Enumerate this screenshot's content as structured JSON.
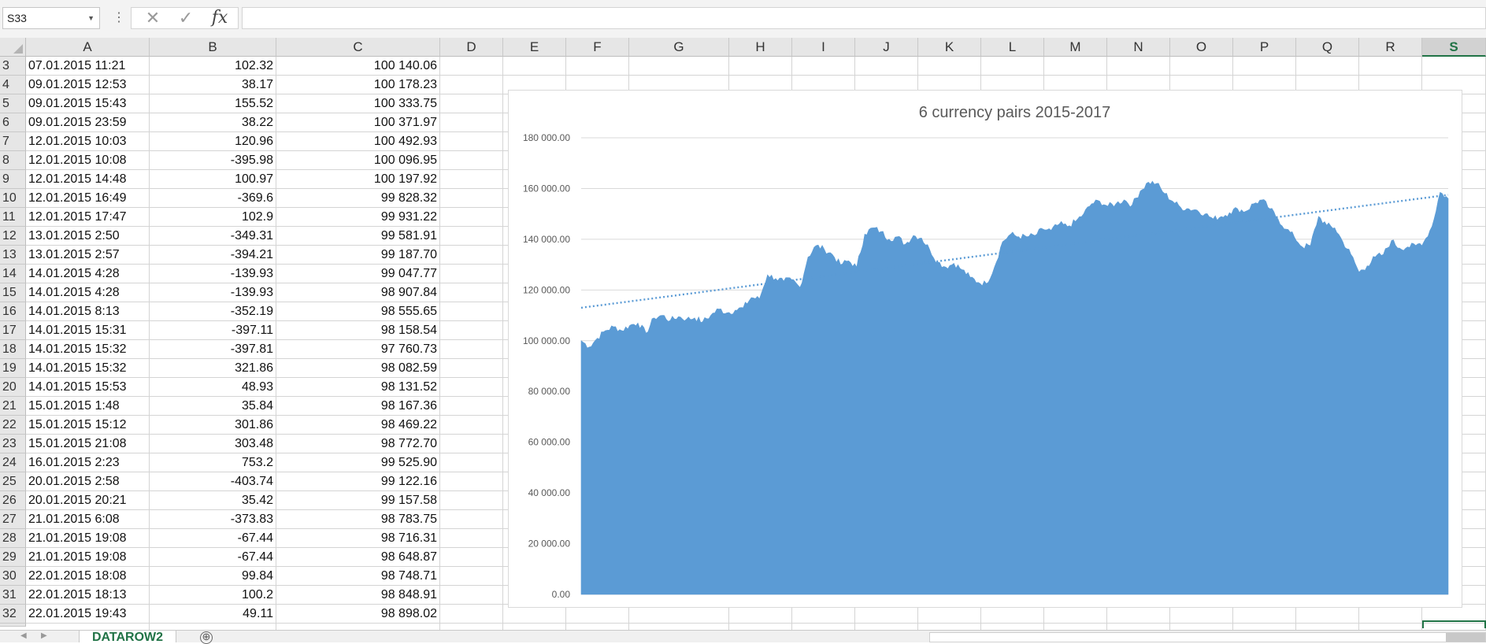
{
  "name_box": {
    "value": "S33"
  },
  "formula_bar": {
    "cancel_icon": "✕",
    "enter_icon": "✓",
    "fx_label": "fx",
    "value": ""
  },
  "columns": [
    "A",
    "B",
    "C",
    "D",
    "E",
    "F",
    "G",
    "H",
    "I",
    "J",
    "K",
    "L",
    "M",
    "N",
    "O",
    "P",
    "Q",
    "R",
    "S"
  ],
  "selected_column": "S",
  "rows": [
    {
      "n": "3",
      "a": "07.01.2015 11:21",
      "b": "102.32",
      "c": "100 140.06"
    },
    {
      "n": "4",
      "a": "09.01.2015 12:53",
      "b": "38.17",
      "c": "100 178.23"
    },
    {
      "n": "5",
      "a": "09.01.2015 15:43",
      "b": "155.52",
      "c": "100 333.75"
    },
    {
      "n": "6",
      "a": "09.01.2015 23:59",
      "b": "38.22",
      "c": "100 371.97"
    },
    {
      "n": "7",
      "a": "12.01.2015 10:03",
      "b": "120.96",
      "c": "100 492.93"
    },
    {
      "n": "8",
      "a": "12.01.2015 10:08",
      "b": "-395.98",
      "c": "100 096.95"
    },
    {
      "n": "9",
      "a": "12.01.2015 14:48",
      "b": "100.97",
      "c": "100 197.92"
    },
    {
      "n": "10",
      "a": "12.01.2015 16:49",
      "b": "-369.6",
      "c": "99 828.32"
    },
    {
      "n": "11",
      "a": "12.01.2015 17:47",
      "b": "102.9",
      "c": "99 931.22"
    },
    {
      "n": "12",
      "a": "13.01.2015 2:50",
      "b": "-349.31",
      "c": "99 581.91"
    },
    {
      "n": "13",
      "a": "13.01.2015 2:57",
      "b": "-394.21",
      "c": "99 187.70"
    },
    {
      "n": "14",
      "a": "14.01.2015 4:28",
      "b": "-139.93",
      "c": "99 047.77"
    },
    {
      "n": "15",
      "a": "14.01.2015 4:28",
      "b": "-139.93",
      "c": "98 907.84"
    },
    {
      "n": "16",
      "a": "14.01.2015 8:13",
      "b": "-352.19",
      "c": "98 555.65"
    },
    {
      "n": "17",
      "a": "14.01.2015 15:31",
      "b": "-397.11",
      "c": "98 158.54"
    },
    {
      "n": "18",
      "a": "14.01.2015 15:32",
      "b": "-397.81",
      "c": "97 760.73"
    },
    {
      "n": "19",
      "a": "14.01.2015 15:32",
      "b": "321.86",
      "c": "98 082.59"
    },
    {
      "n": "20",
      "a": "14.01.2015 15:53",
      "b": "48.93",
      "c": "98 131.52"
    },
    {
      "n": "21",
      "a": "15.01.2015 1:48",
      "b": "35.84",
      "c": "98 167.36"
    },
    {
      "n": "22",
      "a": "15.01.2015 15:12",
      "b": "301.86",
      "c": "98 469.22"
    },
    {
      "n": "23",
      "a": "15.01.2015 21:08",
      "b": "303.48",
      "c": "98 772.70"
    },
    {
      "n": "24",
      "a": "16.01.2015 2:23",
      "b": "753.2",
      "c": "99 525.90"
    },
    {
      "n": "25",
      "a": "20.01.2015 2:58",
      "b": "-403.74",
      "c": "99 122.16"
    },
    {
      "n": "26",
      "a": "20.01.2015 20:21",
      "b": "35.42",
      "c": "99 157.58"
    },
    {
      "n": "27",
      "a": "21.01.2015 6:08",
      "b": "-373.83",
      "c": "98 783.75"
    },
    {
      "n": "28",
      "a": "21.01.2015 19:08",
      "b": "-67.44",
      "c": "98 716.31"
    },
    {
      "n": "29",
      "a": "21.01.2015 19:08",
      "b": "-67.44",
      "c": "98 648.87"
    },
    {
      "n": "30",
      "a": "22.01.2015 18:08",
      "b": "99.84",
      "c": "98 748.71"
    },
    {
      "n": "31",
      "a": "22.01.2015 18:13",
      "b": "100.2",
      "c": "98 848.91"
    },
    {
      "n": "32",
      "a": "22.01.2015 19:43",
      "b": "49.11",
      "c": "98 898.02"
    }
  ],
  "sheet_tab": {
    "label": "DATAROW2",
    "add_icon": "⊕"
  },
  "colors": {
    "accent": "#217346",
    "series": "#5b9bd5",
    "trend": "#5b9bd5"
  },
  "chart_data": {
    "type": "area",
    "title": "6 currency pairs 2015-2017",
    "ylim": [
      0,
      180000
    ],
    "y_ticks": [
      "0.00",
      "20 000.00",
      "40 000.00",
      "60 000.00",
      "80 000.00",
      "100 000.00",
      "120 000.00",
      "140 000.00",
      "160 000.00",
      "180 000.00"
    ],
    "grid": true,
    "legend": "none",
    "series": [
      {
        "values": [
          100000,
          97500,
          101000,
          104000,
          105500,
          104000,
          106000,
          107000,
          103000,
          109000,
          110000,
          108000,
          109500,
          108500,
          109000,
          107500,
          110000,
          112500,
          111000,
          112000,
          113000,
          117000,
          116500,
          126000,
          124500,
          123500,
          124000,
          121000,
          133000,
          137500,
          136000,
          134000,
          130000,
          131500,
          129000,
          142000,
          144500,
          143000,
          140000,
          141000,
          138000,
          141500,
          140500,
          136000,
          131000,
          129000,
          130500,
          128000,
          125000,
          123000,
          122500,
          129000,
          139000,
          142000,
          141000,
          141000,
          141500,
          144000,
          143500,
          146000,
          145000,
          147000,
          150000,
          154000,
          155000,
          153000,
          154000,
          155500,
          153500,
          159000,
          162500,
          162000,
          158000,
          155000,
          152500,
          152000,
          151500,
          150000,
          148000,
          149000,
          150500,
          152000,
          151000,
          154000,
          155500,
          152000,
          148000,
          144000,
          141000,
          137000,
          137500,
          149000,
          145500,
          144500,
          139000,
          134000,
          127000,
          129500,
          133000,
          134000,
          139500,
          136500,
          137000,
          137500,
          139000,
          145000,
          158500,
          156000
        ]
      }
    ],
    "trendline": {
      "start": 113000,
      "end": 157500,
      "style": "dotted"
    }
  }
}
